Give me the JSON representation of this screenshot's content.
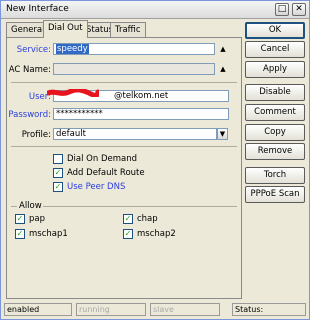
{
  "window": {
    "title": "New Interface"
  },
  "titlebar_buttons": [
    "□",
    "✕"
  ],
  "tabs": [
    {
      "label": "General"
    },
    {
      "label": "Dial Out"
    },
    {
      "label": "Status"
    },
    {
      "label": "Traffic"
    }
  ],
  "form": {
    "service_label": "Service:",
    "service_value": "speedy",
    "acname_label": "AC Name:",
    "acname_value": "",
    "user_label": "User:",
    "user_value_visible": "@telkom.net",
    "password_label": "Password:",
    "password_value": "***********",
    "profile_label": "Profile:",
    "profile_value": "default",
    "arrow_glyph": "▲",
    "dropdown_glyph": "▼"
  },
  "options": {
    "dial_on_demand": {
      "label": "Dial On Demand",
      "checked": false
    },
    "add_default_route": {
      "label": "Add Default Route",
      "checked": true
    },
    "use_peer_dns": {
      "label": "Use Peer DNS",
      "checked": true
    }
  },
  "allow": {
    "title": "Allow",
    "pap": {
      "label": "pap",
      "checked": true
    },
    "chap": {
      "label": "chap",
      "checked": true
    },
    "mschap1": {
      "label": "mschap1",
      "checked": true
    },
    "mschap2": {
      "label": "mschap2",
      "checked": true
    }
  },
  "buttons": {
    "ok": "OK",
    "cancel": "Cancel",
    "apply": "Apply",
    "disable": "Disable",
    "comment": "Comment",
    "copy": "Copy",
    "remove": "Remove",
    "torch": "Torch",
    "pppoe_scan": "PPPoE Scan"
  },
  "statusbar": {
    "enabled": "enabled",
    "running": "running",
    "slave": "slave",
    "status": "Status:"
  },
  "colors": {
    "accent_label": "#2a3ddc",
    "redaction": "#e8141d",
    "selection": "#316ac5"
  }
}
